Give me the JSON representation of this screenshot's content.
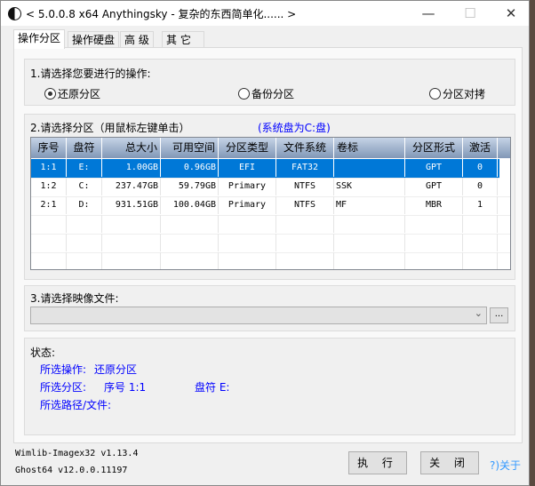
{
  "window": {
    "title": "< 5.0.0.8 x64 Anythingsky - 复杂的东西简单化...... >",
    "minimize": "—",
    "maximize": "☐",
    "close": "✕"
  },
  "tabs": [
    "操作分区",
    "操作硬盘",
    "高 级",
    "其 它"
  ],
  "operation": {
    "label": "1.请选择您要进行的操作:",
    "options": [
      "还原分区",
      "备份分区",
      "分区对拷"
    ],
    "selected": 0
  },
  "partition": {
    "label": "2.请选择分区（用鼠标左键单击）",
    "system_disk": "(系统盘为C:盘)",
    "columns": [
      "序号",
      "盘符",
      "总大小",
      "可用空间",
      "分区类型",
      "文件系统",
      "卷标",
      "分区形式",
      "激活"
    ],
    "rows": [
      [
        "1:1",
        "E:",
        "1.00GB",
        "0.96GB",
        "EFI",
        "FAT32",
        "",
        "GPT",
        "0"
      ],
      [
        "1:2",
        "C:",
        "237.47GB",
        "59.79GB",
        "Primary",
        "NTFS",
        "SSK",
        "GPT",
        "0"
      ],
      [
        "2:1",
        "D:",
        "931.51GB",
        "100.04GB",
        "Primary",
        "NTFS",
        "MF",
        "MBR",
        "1"
      ]
    ],
    "selected_row": 0
  },
  "image": {
    "label": "3.请选择映像文件:",
    "value": "",
    "browse": "..."
  },
  "status": {
    "label": "状态:",
    "op_label": "所选操作:",
    "op_value": "还原分区",
    "part_label": "所选分区:",
    "part_index": "序号 1:1",
    "part_drive": "盘符 E:",
    "path_label": "所选路径/文件:"
  },
  "footer": {
    "wimlib": "Wimlib-Imagex32 v1.13.4",
    "ghost": "Ghost64 v12.0.0.11197",
    "execute": "执 行",
    "close": "关 闭",
    "about": "?)关于"
  },
  "colors": {
    "selection": "#0078d7",
    "status_text": "#0000ff",
    "about_link": "#3399ff"
  }
}
